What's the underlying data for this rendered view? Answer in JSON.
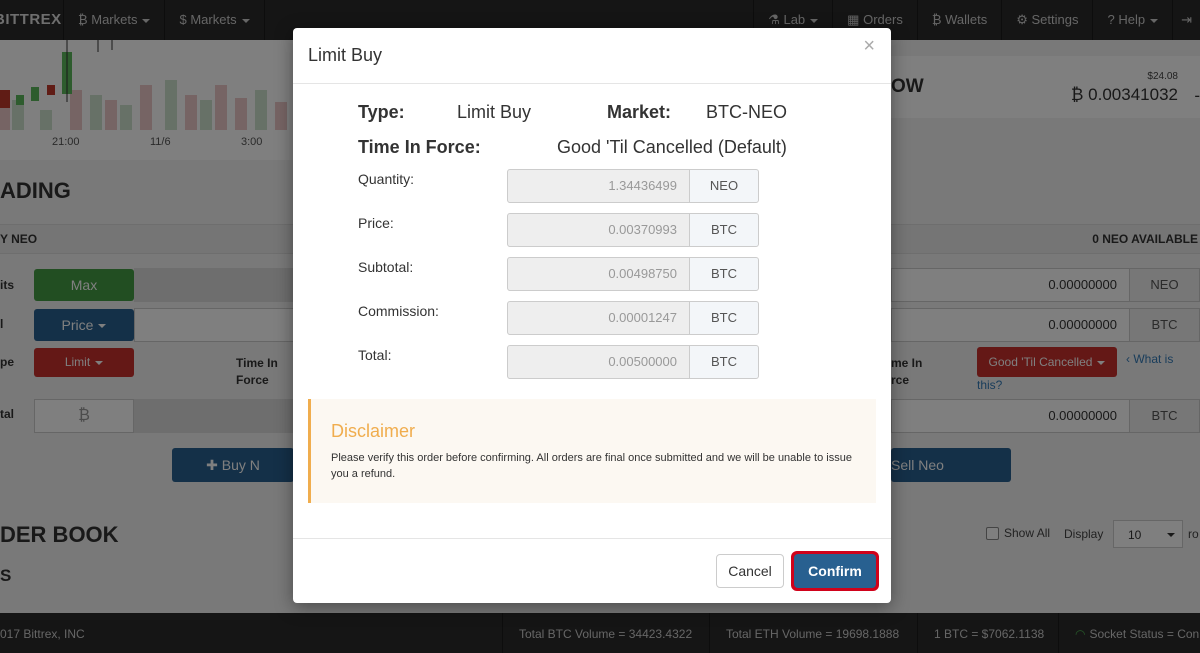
{
  "nav": {
    "brand": "BITTREX",
    "left_items": [
      {
        "label": "Markets",
        "icon": "bitcoin-icon"
      },
      {
        "label": "Markets",
        "icon": "dollar-icon"
      }
    ],
    "right_items": [
      {
        "label": "Lab",
        "icon": "flask-icon",
        "caret": true
      },
      {
        "label": "Orders",
        "icon": "calendar-icon",
        "caret": false
      },
      {
        "label": "Wallets",
        "icon": "bitcoin-icon",
        "caret": false
      },
      {
        "label": "Settings",
        "icon": "gear-icon",
        "caret": false
      },
      {
        "label": "Help",
        "icon": "question-icon",
        "caret": true
      }
    ]
  },
  "chart": {
    "ticks": [
      "21:00",
      "11/6",
      "3:00"
    ]
  },
  "market_header": {
    "symbol_tail": "OW",
    "usd_price": "$24.08",
    "btc_price": "0.00341032"
  },
  "trading": {
    "title_tail": "ADING",
    "buy_bar_left": "Y NEO",
    "available": "0 NEO AVAILABLE",
    "row_labels": [
      "its",
      "l",
      "pe",
      "tal"
    ],
    "max_label": "Max",
    "price_label": "Price",
    "limit_label": "Limit",
    "tif_left": "Time In Force",
    "tif_right": "me In rce",
    "gtc_label": "Good 'Til Cancelled",
    "what_is": "What is",
    "this_q": "this?",
    "sell_values": [
      "0.00000000",
      "0.00000000",
      "0.00000000"
    ],
    "sell_units": [
      "NEO",
      "BTC",
      "BTC"
    ],
    "buy_btn": "Buy N",
    "sell_btn": "Sell Neo"
  },
  "order_book": {
    "title_tail": "DER BOOK",
    "sub_tail": "S",
    "show_all": "Show All",
    "display_label": "Display",
    "display_value": "10",
    "ro": "ro"
  },
  "status": {
    "copyright": "017 Bittrex, INC",
    "btc_volume": "Total BTC Volume = 34423.4322",
    "eth_volume": "Total ETH Volume = 19698.1888",
    "btc_usd": "1 BTC = $7062.1138",
    "socket": "Socket Status = Con"
  },
  "modal": {
    "title": "Limit Buy",
    "close": "×",
    "type_label": "Type:",
    "type_value": "Limit Buy",
    "market_label": "Market:",
    "market_value": "BTC-NEO",
    "tif_label": "Time In Force:",
    "tif_value": "Good 'Til Cancelled (Default)",
    "fields": [
      {
        "label": "Quantity:",
        "value": "1.34436499",
        "unit": "NEO"
      },
      {
        "label": "Price:",
        "value": "0.00370993",
        "unit": "BTC"
      },
      {
        "label": "Subtotal:",
        "value": "0.00498750",
        "unit": "BTC"
      },
      {
        "label": "Commission:",
        "value": "0.00001247",
        "unit": "BTC"
      },
      {
        "label": "Total:",
        "value": "0.00500000",
        "unit": "BTC"
      }
    ],
    "disclaimer_title": "Disclaimer",
    "disclaimer_text": "Please verify this order before confirming. All orders are final once submitted and we will be unable to issue you a refund.",
    "cancel": "Cancel",
    "confirm": "Confirm"
  },
  "colors": {
    "accent_blue": "#286090",
    "danger_red": "#c9302c",
    "success_green": "#449d44",
    "warning_orange": "#f0ad4e",
    "highlight_ring": "#d0021b"
  }
}
